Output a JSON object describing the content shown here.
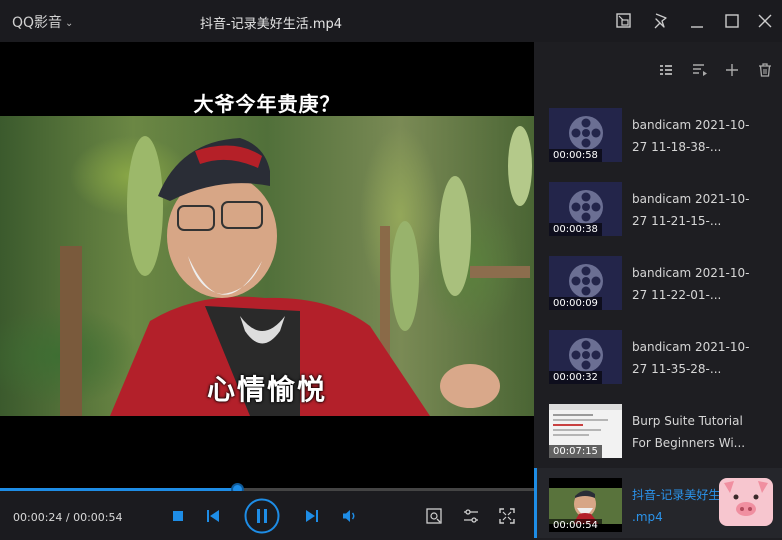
{
  "titlebar": {
    "app_name": "QQ影音",
    "file_title": "抖音-记录美好生活.mp4"
  },
  "video": {
    "subtitle_top": "大爷今年贵庚？",
    "subtitle_bottom": "心情愉悦"
  },
  "player": {
    "time": "00:00:24 / 00:00:54",
    "progress_fraction": 0.444
  },
  "playlist": {
    "items": [
      {
        "title": "bandicam 2021-10-\n27 11-18-38-...",
        "duration": "00:00:58",
        "thumb": "reel-icon"
      },
      {
        "title": "bandicam 2021-10-\n27 11-21-15-...",
        "duration": "00:00:38",
        "thumb": "reel-icon"
      },
      {
        "title": "bandicam 2021-10-\n27 11-22-01-...",
        "duration": "00:00:09",
        "thumb": "reel-icon"
      },
      {
        "title": "bandicam 2021-10-\n27 11-35-28-...",
        "duration": "00:00:32",
        "thumb": "reel-icon"
      },
      {
        "title": "Burp Suite Tutorial\nFor Beginners Wi...",
        "duration": "00:07:15",
        "thumb": "screenshot"
      },
      {
        "title": "抖音-记录美好生\n.mp4",
        "duration": "00:00:54",
        "thumb": "video-frame",
        "active": true
      }
    ]
  },
  "colors": {
    "accent": "#1e8de6",
    "background": "#1b1b1f",
    "sidebar": "#1e1e22"
  }
}
